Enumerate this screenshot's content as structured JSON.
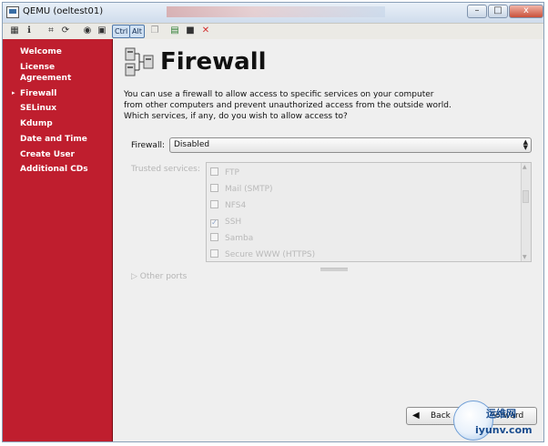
{
  "window": {
    "title": "QEMU (oeltest01)",
    "controls": {
      "minimize": "–",
      "maximize": "□",
      "close": "x"
    }
  },
  "toolbar": {
    "icons": [
      "properties-icon",
      "info-icon",
      "network-icon",
      "refresh-icon",
      "record-icon",
      "fullscreen-icon",
      "copy-icon",
      "paste-icon",
      "save-icon",
      "close-x-icon"
    ],
    "ctrl_label": "Ctrl",
    "alt_label": "Alt"
  },
  "sidebar": {
    "items": [
      {
        "label": "Welcome",
        "current": false
      },
      {
        "label": "License Agreement",
        "current": false
      },
      {
        "label": "Firewall",
        "current": true
      },
      {
        "label": "SELinux",
        "current": false
      },
      {
        "label": "Kdump",
        "current": false
      },
      {
        "label": "Date and Time",
        "current": false
      },
      {
        "label": "Create User",
        "current": false
      },
      {
        "label": "Additional CDs",
        "current": false
      }
    ],
    "current_marker": "▸",
    "color": "#bf1e2e"
  },
  "main": {
    "heading": "Firewall",
    "intro": "You can use a firewall to allow access to specific services on your computer from other computers and prevent unauthorized access from the outside world.  Which services, if any, do you wish to allow access to?",
    "firewall_label": "Firewall:",
    "firewall_value": "Disabled",
    "trusted_label": "Trusted services:",
    "services": [
      {
        "label": "FTP",
        "checked": false
      },
      {
        "label": "Mail (SMTP)",
        "checked": false
      },
      {
        "label": "NFS4",
        "checked": false
      },
      {
        "label": "SSH",
        "checked": true
      },
      {
        "label": "Samba",
        "checked": false
      },
      {
        "label": "Secure WWW (HTTPS)",
        "checked": false
      }
    ],
    "other_ports_label": "Other ports"
  },
  "buttons": {
    "back": "Back",
    "forward": "Forward"
  },
  "watermark": {
    "line1": "运维网",
    "line2": "iyunv.com"
  }
}
